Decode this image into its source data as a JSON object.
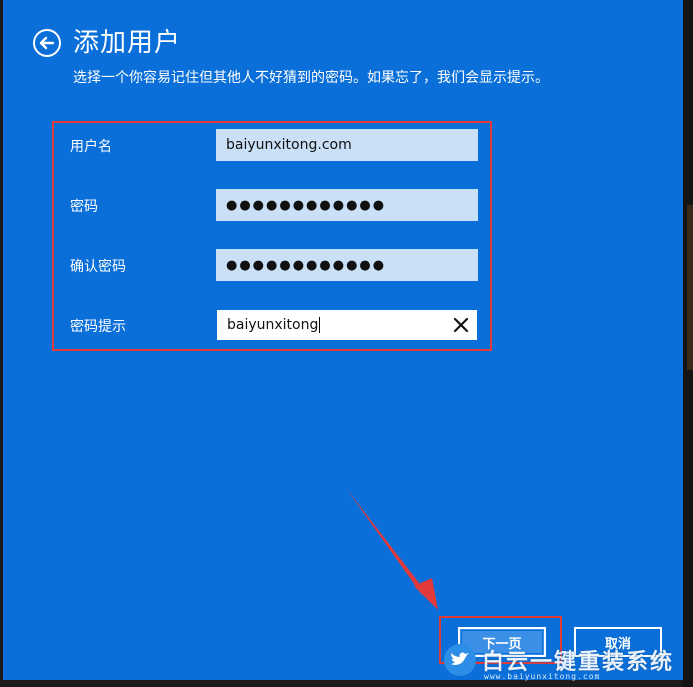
{
  "header": {
    "title": "添加用户",
    "subtitle": "选择一个你容易记住但其他人不好猜到的密码。如果忘了，我们会显示提示。"
  },
  "form": {
    "username": {
      "label": "用户名",
      "value": "baiyunxitong.com"
    },
    "password": {
      "label": "密码",
      "value": "●●●●●●●●●●●●"
    },
    "confirm": {
      "label": "确认密码",
      "value": "●●●●●●●●●●●●"
    },
    "hint": {
      "label": "密码提示",
      "value": "baiyunxitong"
    }
  },
  "buttons": {
    "next": "下一页",
    "cancel": "取消"
  },
  "watermark": {
    "brand": "白云一键重装系统",
    "url": "www.baiyunxitong.com"
  },
  "colors": {
    "background": "#0a6fd8",
    "input_fill": "#c9e0f7",
    "highlight": "#e23a3a"
  }
}
